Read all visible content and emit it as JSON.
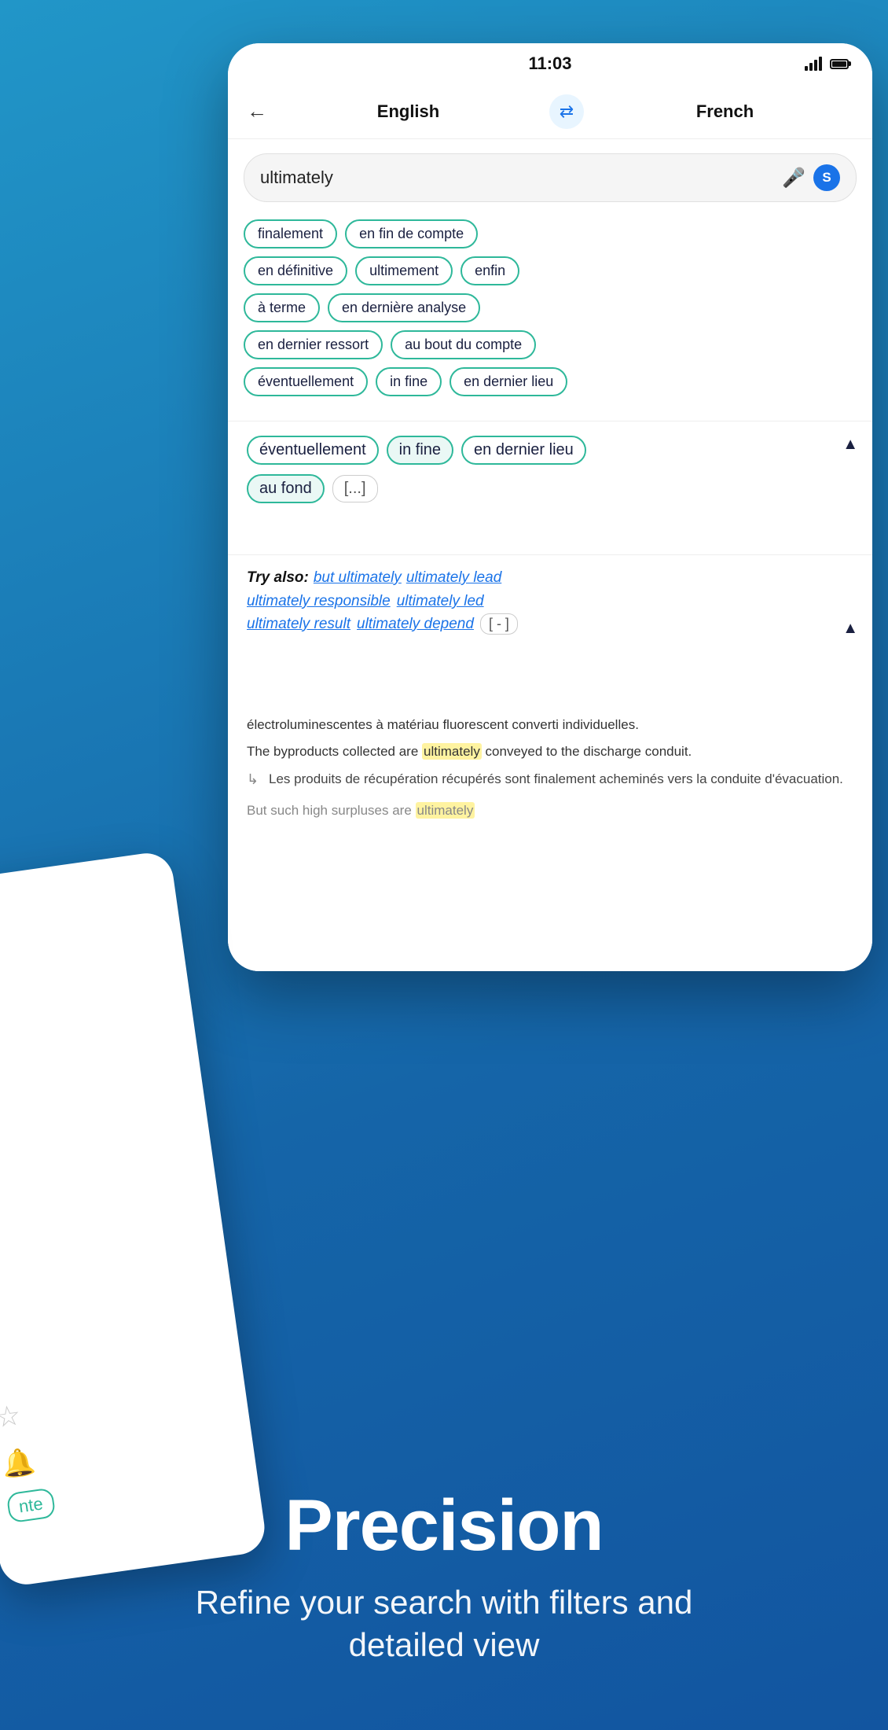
{
  "status_bar": {
    "time": "11:03",
    "signal": "signal",
    "battery": "battery"
  },
  "header": {
    "back_label": "←",
    "lang_from": "English",
    "swap_label": "⇄",
    "lang_to": "French"
  },
  "search": {
    "query": "ultimately",
    "mic_label": "🎤",
    "s_label": "S"
  },
  "translations": {
    "row1": [
      "finalement",
      "en fin de compte"
    ],
    "row2": [
      "en définitive",
      "ultimement",
      "enfin"
    ],
    "row3": [
      "à terme",
      "en dernière analyse"
    ],
    "row4": [
      "en dernier ressort",
      "au bout du compte"
    ],
    "row5": [
      "éventuellement",
      "in fine",
      "en dernier lieu"
    ]
  },
  "expanded": {
    "row1": [
      "éventuellement",
      "in fine",
      "en dernier lieu"
    ],
    "row2_chip1": "au fond",
    "row2_ellipsis": "[...]",
    "collapse_icon": "▲"
  },
  "try_also": {
    "label": "Try also:",
    "links": [
      "but ultimately",
      "ultimately lead",
      "ultimately responsible",
      "ultimately led",
      "ultimately result",
      "ultimately depend"
    ],
    "dash": "[ - ]",
    "collapse_icon": "▲"
  },
  "examples": {
    "sentence1_pre": "The byproducts collected are ",
    "sentence1_highlight": "ultimately",
    "sentence1_post": " conveyed to the discharge conduit.",
    "translation1": "Les produits de récupération récupérés sont finalement acheminés vers la conduite d'évacuation.",
    "sentence2_pre": "But such high surpluses are ",
    "sentence2_highlight": "ultimately",
    "sentence2_post": "",
    "french_partial": "électroluminescentes à matériau fluorescent converti individuelles."
  },
  "marketing": {
    "title": "Precision",
    "subtitle": "Refine your search with filters and detailed view"
  },
  "second_phone": {
    "partial_word": "nte"
  }
}
